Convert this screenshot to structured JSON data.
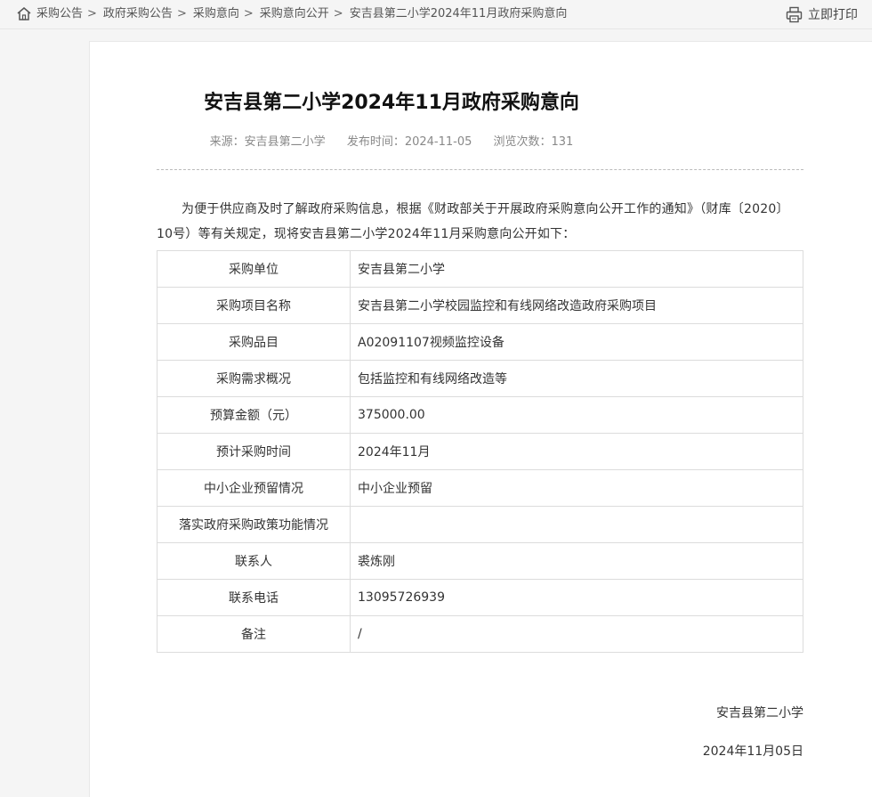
{
  "breadcrumb": {
    "items": [
      "采购公告",
      "政府采购公告",
      "采购意向",
      "采购意向公开",
      "安吉县第二小学2024年11月政府采购意向"
    ],
    "separator": ">"
  },
  "toolbar": {
    "print_label": "立即打印",
    "print_icon": "printer-icon",
    "home_icon": "home-icon"
  },
  "article": {
    "title": "安吉县第二小学2024年11月政府采购意向",
    "source": "来源：安吉县第二小学",
    "publish_time": "发布时间：2024-11-05",
    "views": "浏览次数：131",
    "intro": "为便于供应商及时了解政府采购信息，根据《财政部关于开展政府采购意向公开工作的通知》（财库〔2020〕10号）等有关规定，现将安吉县第二小学2024年11月采购意向公开如下：",
    "rows": [
      {
        "key": "采购单位",
        "value": "安吉县第二小学"
      },
      {
        "key": "采购项目名称",
        "value": "安吉县第二小学校园监控和有线网络改造政府采购项目"
      },
      {
        "key": "采购品目",
        "value": "A02091107视频监控设备"
      },
      {
        "key": "采购需求概况",
        "value": "包括监控和有线网络改造等"
      },
      {
        "key": "预算金额（元）",
        "value": "375000.00"
      },
      {
        "key": "预计采购时间",
        "value": "2024年11月"
      },
      {
        "key": "中小企业预留情况",
        "value": "中小企业预留"
      },
      {
        "key": "落实政府采购政策功能情况",
        "value": ""
      },
      {
        "key": "联系人",
        "value": "裘炼刚"
      },
      {
        "key": "联系电话",
        "value": "13095726939"
      },
      {
        "key": "备注",
        "value": "/"
      }
    ],
    "signature": "安吉县第二小学",
    "sign_date": "2024年11月05日"
  }
}
